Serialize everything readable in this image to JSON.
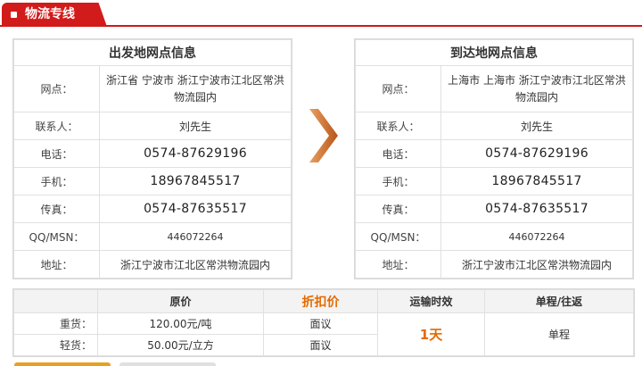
{
  "tab": {
    "label": "物流专线"
  },
  "origin": {
    "title": "出发地网点信息",
    "rows": [
      {
        "label": "网点：",
        "value": "浙江省 宁波市 浙江宁波市江北区常洪物流园内"
      },
      {
        "label": "联系人：",
        "value": "刘先生"
      },
      {
        "label": "电话：",
        "value": "0574-87629196"
      },
      {
        "label": "手机：",
        "value": "18967845517"
      },
      {
        "label": "传真：",
        "value": "0574-87635517"
      },
      {
        "label": "QQ/MSN：",
        "value": "446072264"
      },
      {
        "label": "地址：",
        "value": "浙江宁波市江北区常洪物流园内"
      }
    ]
  },
  "destination": {
    "title": "到达地网点信息",
    "rows": [
      {
        "label": "网点：",
        "value": "上海市 上海市 浙江宁波市江北区常洪物流园内"
      },
      {
        "label": "联系人：",
        "value": "刘先生"
      },
      {
        "label": "电话：",
        "value": "0574-87629196"
      },
      {
        "label": "手机：",
        "value": "18967845517"
      },
      {
        "label": "传真：",
        "value": "0574-87635517"
      },
      {
        "label": "QQ/MSN：",
        "value": "446072264"
      },
      {
        "label": "地址：",
        "value": "浙江宁波市江北区常洪物流园内"
      }
    ]
  },
  "pricing": {
    "headers": {
      "original": "原价",
      "discount": "折扣价",
      "time": "运输时效",
      "trip": "单程/往返"
    },
    "heavy": {
      "label": "重货：",
      "original": "120.00元/吨",
      "discount": "面议"
    },
    "light": {
      "label": "轻货：",
      "original": "50.00元/立方",
      "discount": "面议"
    },
    "time": "1天",
    "trip": "单程"
  },
  "colors": {
    "accent": "#d21b1b",
    "highlight": "#e56a00",
    "arrow": "#d2691e"
  }
}
